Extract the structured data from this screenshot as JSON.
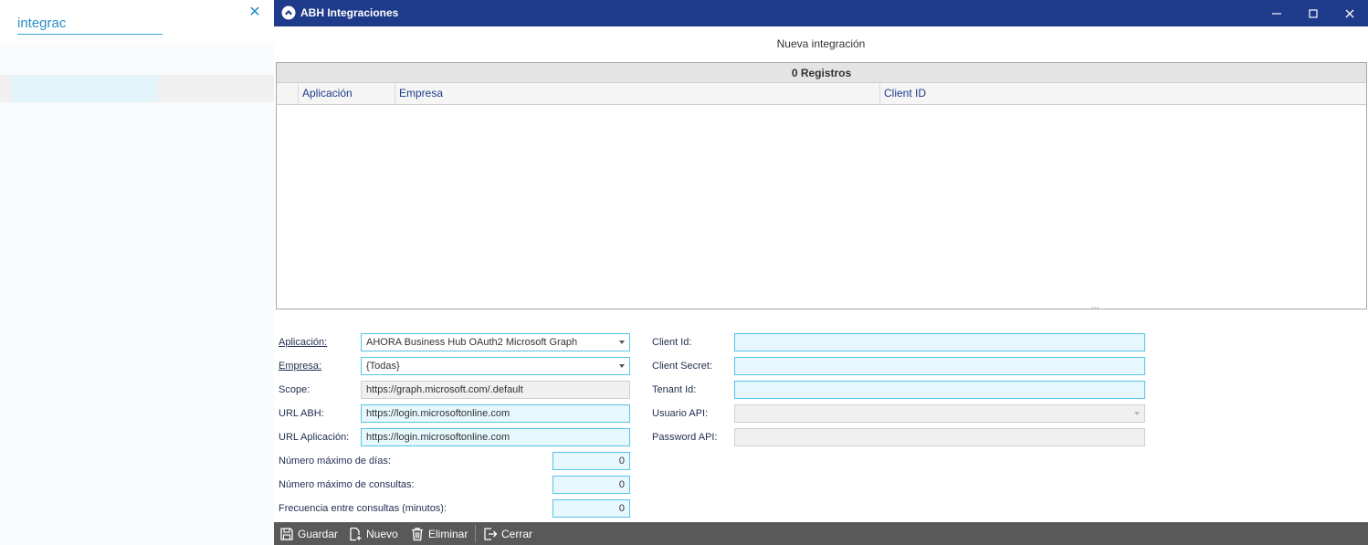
{
  "search": {
    "value": "integrac",
    "clear_icon": "close-icon"
  },
  "window": {
    "title": "ABH Integraciones",
    "controls": {
      "minimize": "minimize-icon",
      "maximize": "maximize-icon",
      "close": "close-icon"
    }
  },
  "heading": "Nueva integración",
  "grid": {
    "count_label": "0 Registros",
    "columns": [
      "Aplicación",
      "Empresa",
      "Client ID"
    ],
    "rows": []
  },
  "form": {
    "aplicacion": {
      "label": "Aplicación:",
      "value": "AHORA Business Hub OAuth2 Microsoft Graph"
    },
    "empresa": {
      "label": "Empresa:",
      "value": "{Todas}"
    },
    "scope": {
      "label": "Scope:",
      "value": "https://graph.microsoft.com/.default"
    },
    "url_abh": {
      "label": "URL ABH:",
      "value": "https://login.microsoftonline.com"
    },
    "url_aplicacion": {
      "label": "URL Aplicación:",
      "value": "https://login.microsoftonline.com"
    },
    "max_dias": {
      "label": "Número máximo de días:",
      "value": "0"
    },
    "max_consultas": {
      "label": "Número máximo de consultas:",
      "value": "0"
    },
    "frecuencia": {
      "label": "Frecuencia entre consultas (minutos):",
      "value": "0"
    },
    "client_id": {
      "label": "Client Id:",
      "value": ""
    },
    "client_secret": {
      "label": "Client Secret:",
      "value": ""
    },
    "tenant_id": {
      "label": "Tenant Id:",
      "value": ""
    },
    "usuario_api": {
      "label": "Usuario API:",
      "value": ""
    },
    "password_api": {
      "label": "Password API:",
      "value": ""
    }
  },
  "toolbar": {
    "guardar": "Guardar",
    "nuevo": "Nuevo",
    "eliminar": "Eliminar",
    "cerrar": "Cerrar"
  },
  "colors": {
    "titlebar": "#1e3a8a",
    "accent": "#2a8fc7",
    "field_border": "#58c3e6",
    "field_bg": "#e6f7fd",
    "toolbar": "#595959"
  }
}
